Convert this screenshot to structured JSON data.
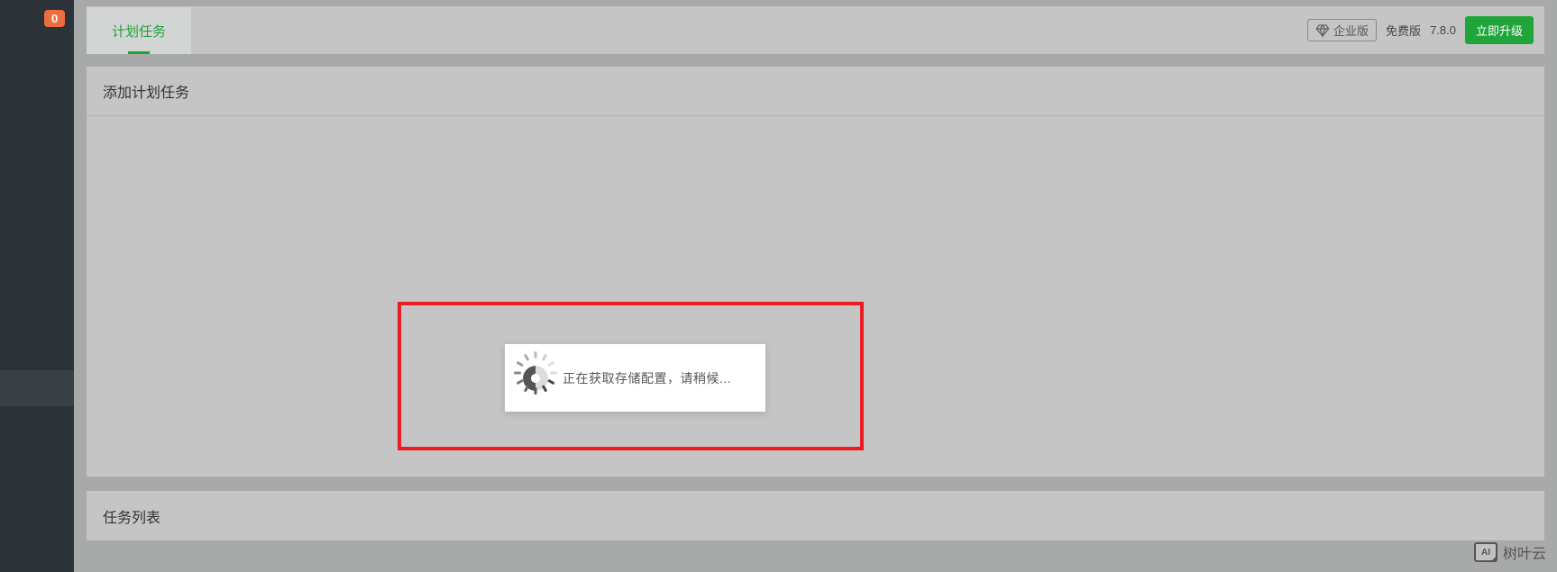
{
  "sidebar": {
    "badge_count": "0"
  },
  "header": {
    "tab_label": "计划任务",
    "enterprise_label": "企业版",
    "free_label": "免费版",
    "version": "7.8.0",
    "upgrade_label": "立即升级"
  },
  "section": {
    "add_task_title": "添加计划任务",
    "task_list_title": "任务列表"
  },
  "modal": {
    "loading_text": "正在获取存储配置，请稍候..."
  },
  "watermark": {
    "icon_text": "AI",
    "label": "树叶云"
  }
}
